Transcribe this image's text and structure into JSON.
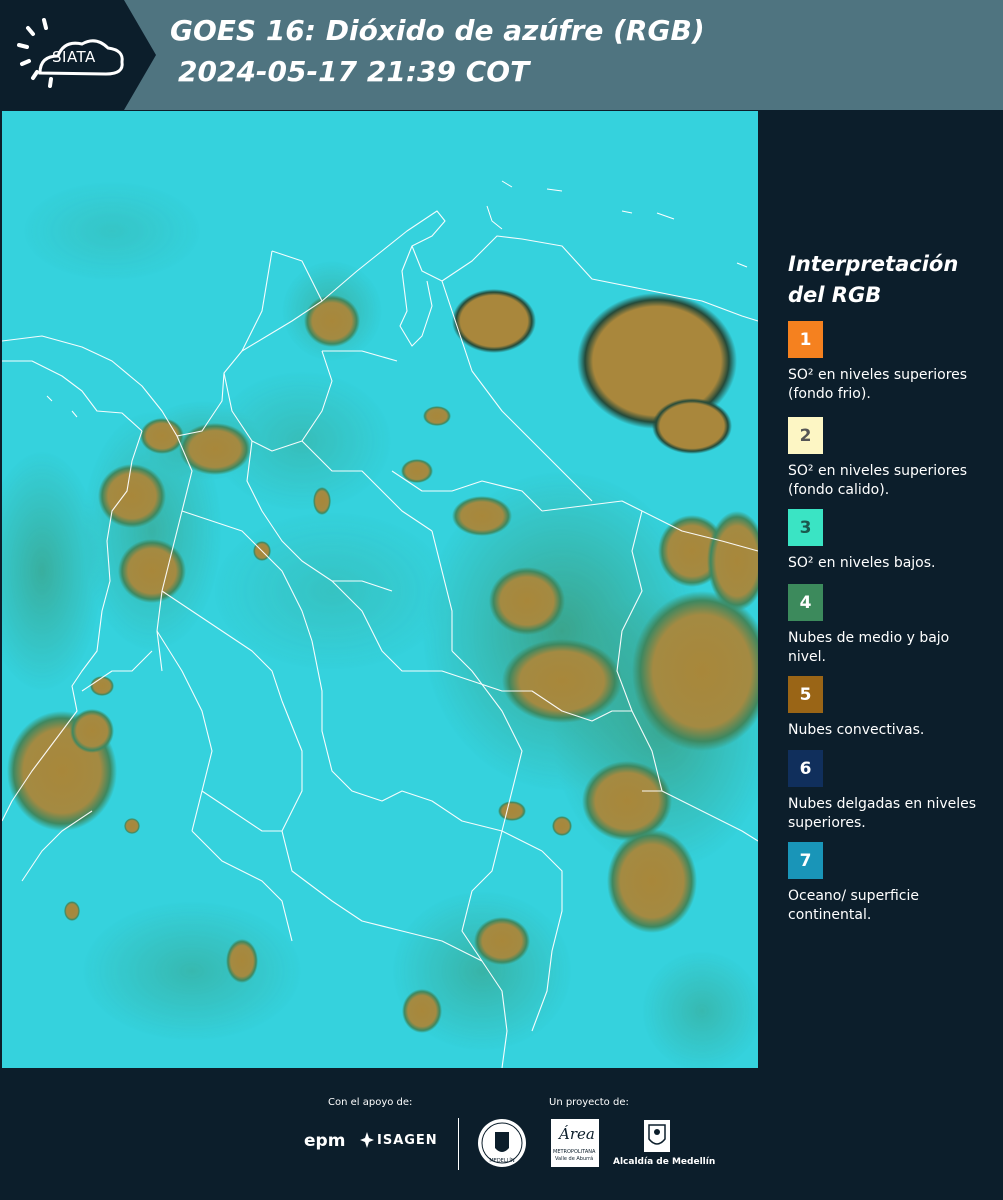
{
  "header": {
    "logo_text": "SIATA",
    "title": "GOES 16: Dióxido de azúfre (RGB)",
    "datetime": "2024-05-17 21:39 COT",
    "bg_color": "#4f7480"
  },
  "legend": {
    "title_line1": "Interpretación",
    "title_line2": "del RGB",
    "items": [
      {
        "number": "1",
        "label": "SO² en niveles superiores (fondo frio).",
        "color": "#f5811f",
        "text_color": "#ffffff"
      },
      {
        "number": "2",
        "label": "SO² en niveles superiores (fondo calido).",
        "color": "#fdf6c4",
        "text_color": "#555555"
      },
      {
        "number": "3",
        "label": "SO² en niveles bajos.",
        "color": "#3ae4c4",
        "text_color": "#1a5a4e"
      },
      {
        "number": "4",
        "label": "Nubes de medio y bajo nivel.",
        "color": "#3c8a5c",
        "text_color": "#ffffff"
      },
      {
        "number": "5",
        "label": "Nubes convectivas.",
        "color": "#9a6516",
        "text_color": "#ffffff"
      },
      {
        "number": "6",
        "label": "Nubes delgadas en niveles superiores.",
        "color": "#102f5c",
        "text_color": "#ffffff"
      },
      {
        "number": "7",
        "label": "Oceano/ superficie continental.",
        "color": "#1995b8",
        "text_color": "#ffffff"
      }
    ]
  },
  "footer": {
    "support_label": "Con el apoyo de:",
    "project_label": "Un proyecto de:",
    "sponsors": [
      "epm",
      "ISAGEN"
    ],
    "partners": {
      "area_name": "Área",
      "area_subtitle1": "METROPOLITANA",
      "area_subtitle2": "Valle de Aburrá",
      "medellin_seal_text": "MEDELLÍN",
      "alcaldia": "Alcaldía de Medellín"
    }
  },
  "map": {
    "background_color": "#35d2dd",
    "convective_color": "#a88a3e",
    "border_color": "#ffffff"
  }
}
